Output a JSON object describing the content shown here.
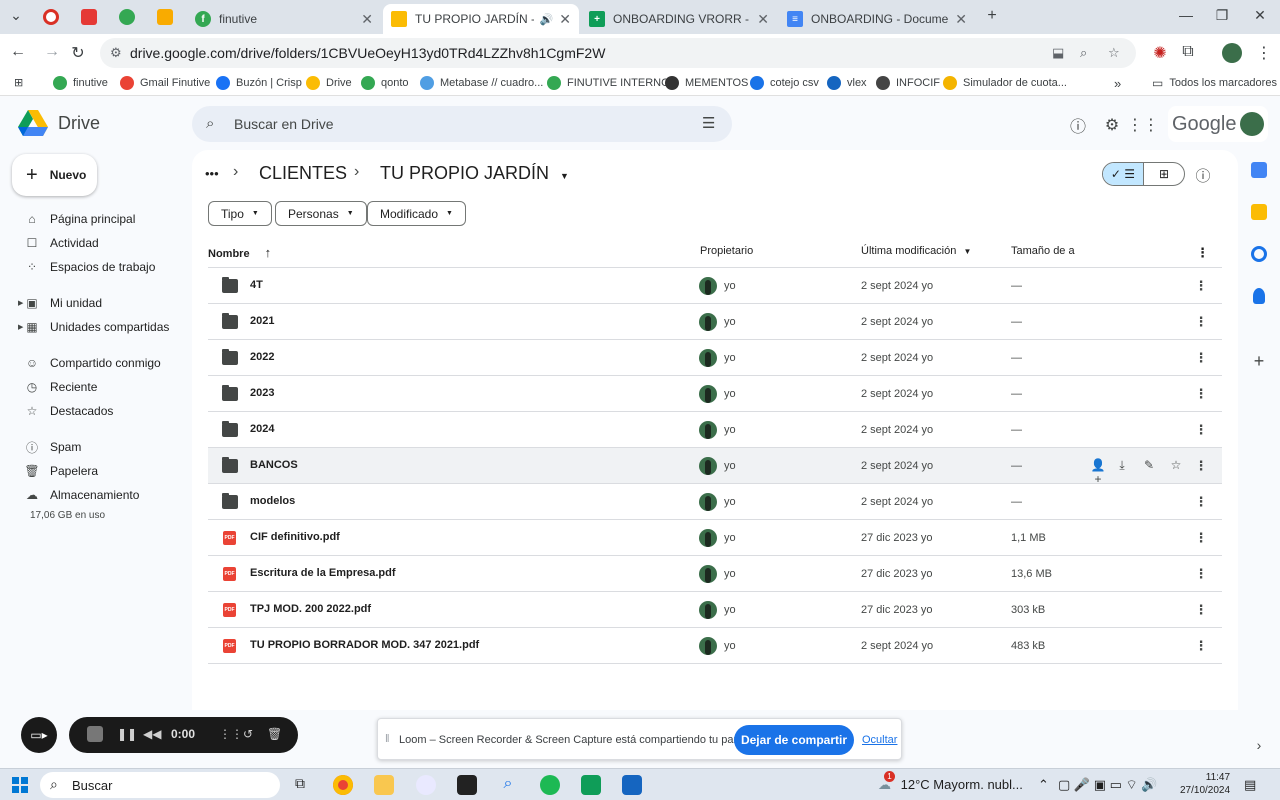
{
  "browser": {
    "tabs": [
      {
        "title": "finutive",
        "color": "#34a853",
        "icon": "finutive-favicon"
      },
      {
        "title": "TU PROPIO JARDÍN - Google Drive",
        "color": "#1a73e8",
        "icon": "drive-favicon",
        "active": true
      },
      {
        "title": "ONBOARDING VRORR - Hojas de cálculo",
        "color": "#0f9d58",
        "icon": "sheets-favicon"
      },
      {
        "title": "ONBOARDING - Documentos de Google",
        "color": "#4285f4",
        "icon": "docs-favicon"
      }
    ],
    "new_tab": "+",
    "url": "drive.google.com/drive/folders/1CBVUeOeyH13yd0TRd4LZZhv8h1CgmF2W",
    "bookmarks": [
      {
        "label": "finutive",
        "color": "#34a853"
      },
      {
        "label": "Gmail Finutive",
        "color": "#ea4335"
      },
      {
        "label": "Buzón | Crisp",
        "color": "#1972f5"
      },
      {
        "label": "Drive",
        "color": "#fbbc04"
      },
      {
        "label": "qonto",
        "color": "#34a853"
      },
      {
        "label": "Metabase // cuadro...",
        "color": "#509ee3"
      },
      {
        "label": "FINUTIVE INTERNO",
        "color": "#34a853"
      },
      {
        "label": "MEMENTOS",
        "color": "#333333"
      },
      {
        "label": "cotejo csv",
        "color": "#1a73e8"
      },
      {
        "label": "vlex",
        "color": "#1565c0"
      },
      {
        "label": "INFOCIF",
        "color": "#444444"
      },
      {
        "label": "Simulador de cuota...",
        "color": "#f4b400"
      }
    ],
    "all_bookmarks": "Todos los marcadores"
  },
  "drive": {
    "app_name": "Drive",
    "search_placeholder": "Buscar en Drive",
    "account_label": "Google",
    "new_button": "Nuevo",
    "nav": [
      {
        "label": "Página principal",
        "icon": "home-icon"
      },
      {
        "label": "Actividad",
        "icon": "activity-icon"
      },
      {
        "label": "Espacios de trabajo",
        "icon": "workspaces-icon"
      },
      {
        "label": "Mi unidad",
        "icon": "my-drive-icon"
      },
      {
        "label": "Unidades compartidas",
        "icon": "shared-drives-icon"
      },
      {
        "label": "Compartido conmigo",
        "icon": "shared-with-me-icon"
      },
      {
        "label": "Reciente",
        "icon": "recent-icon"
      },
      {
        "label": "Destacados",
        "icon": "starred-icon"
      },
      {
        "label": "Spam",
        "icon": "spam-icon"
      },
      {
        "label": "Papelera",
        "icon": "trash-icon"
      },
      {
        "label": "Almacenamiento",
        "icon": "storage-icon"
      }
    ],
    "storage_text": "17,06 GB en uso",
    "breadcrumb": {
      "ellipsis": "•••",
      "parent": "CLIENTES",
      "current": "TU PROPIO JARDÍN"
    },
    "filters": [
      "Tipo",
      "Personas",
      "Modificado"
    ],
    "columns": {
      "name": "Nombre",
      "owner": "Propietario",
      "modified": "Última modificación",
      "size": "Tamaño de a"
    },
    "rows": [
      {
        "name": "4T",
        "type": "folder",
        "owner": "yo",
        "modified": "2 sept 2024 yo",
        "size": "—"
      },
      {
        "name": "2021",
        "type": "folder",
        "owner": "yo",
        "modified": "2 sept 2024 yo",
        "size": "—"
      },
      {
        "name": "2022",
        "type": "folder",
        "owner": "yo",
        "modified": "2 sept 2024 yo",
        "size": "—"
      },
      {
        "name": "2023",
        "type": "folder",
        "owner": "yo",
        "modified": "2 sept 2024 yo",
        "size": "—"
      },
      {
        "name": "2024",
        "type": "folder",
        "owner": "yo",
        "modified": "2 sept 2024 yo",
        "size": "—"
      },
      {
        "name": "BANCOS",
        "type": "folder",
        "owner": "yo",
        "modified": "2 sept 2024 yo",
        "size": "—",
        "hover": true
      },
      {
        "name": "modelos",
        "type": "folder",
        "owner": "yo",
        "modified": "2 sept 2024 yo",
        "size": "—"
      },
      {
        "name": "CIF definitivo.pdf",
        "type": "pdf",
        "owner": "yo",
        "modified": "27 dic 2023 yo",
        "size": "1,1 MB"
      },
      {
        "name": "Escritura de la Empresa.pdf",
        "type": "pdf",
        "owner": "yo",
        "modified": "27 dic 2023 yo",
        "size": "13,6 MB"
      },
      {
        "name": "TPJ MOD. 200 2022.pdf",
        "type": "pdf",
        "owner": "yo",
        "modified": "27 dic 2023 yo",
        "size": "303 kB"
      },
      {
        "name": "TU PROPIO BORRADOR MOD. 347 2021.pdf",
        "type": "pdf",
        "owner": "yo",
        "modified": "2 sept 2024 yo",
        "size": "483 kB"
      }
    ]
  },
  "loom": {
    "timer": "0:00",
    "share_message": "Loom – Screen Recorder & Screen Capture está compartiendo tu pantalla.",
    "stop_label": "Dejar de compartir",
    "hide_label": "Ocultar"
  },
  "taskbar": {
    "search_placeholder": "Buscar",
    "weather": "12°C  Mayorm. nubl...",
    "time": "11:47",
    "date": "27/10/2024",
    "notification_count": "1"
  }
}
